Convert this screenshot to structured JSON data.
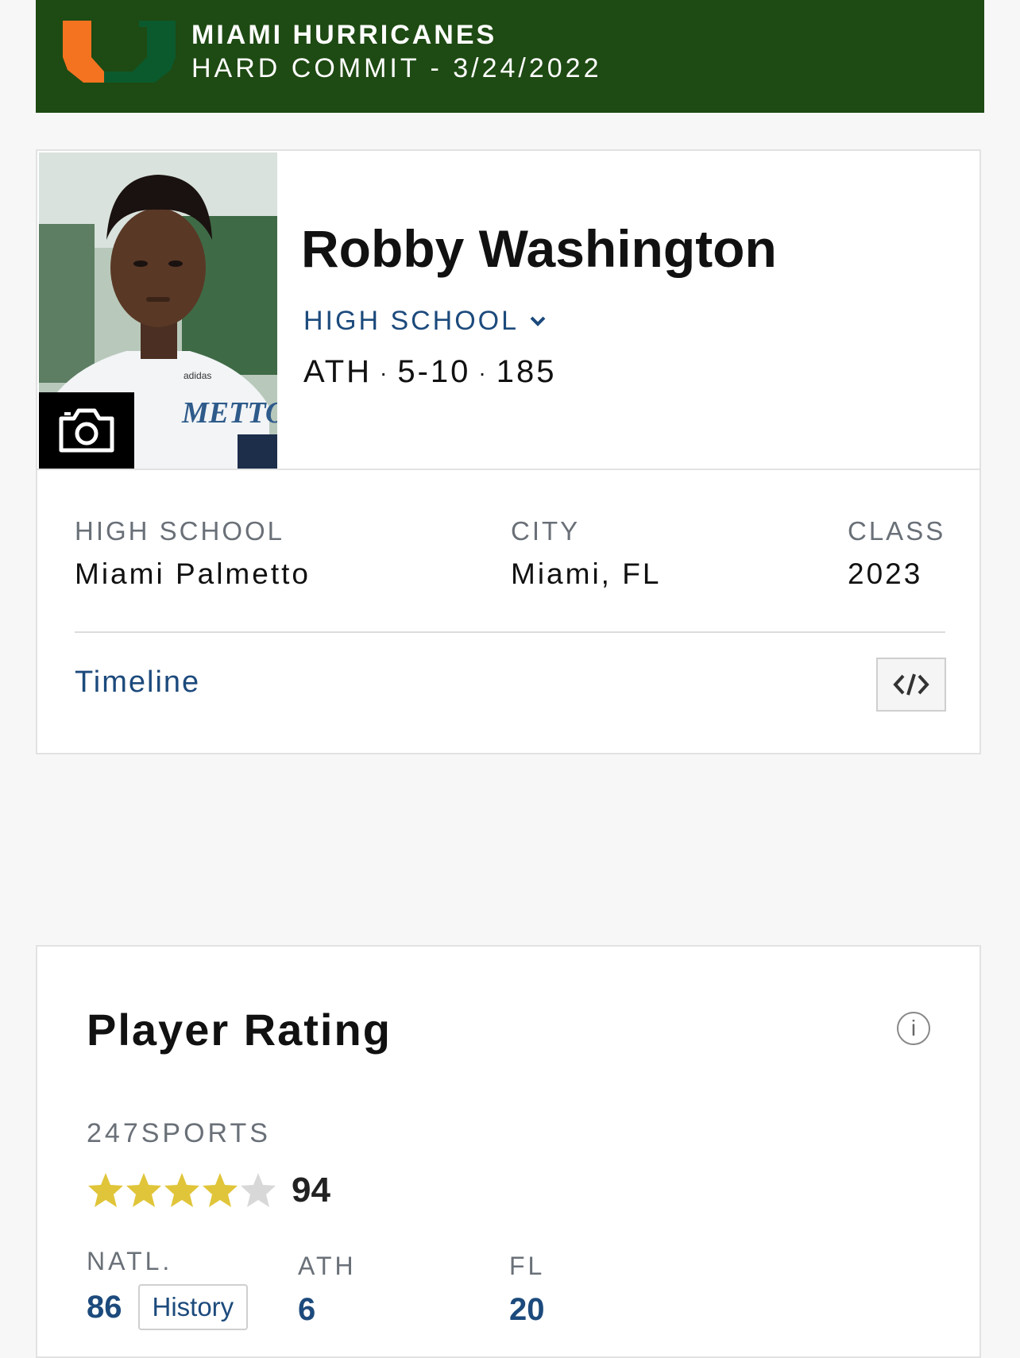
{
  "banner": {
    "team": "MIAMI HURRICANES",
    "commit_status": "HARD COMMIT - 3/24/2022",
    "logo_colors": {
      "orange": "#f47321",
      "green": "#005030"
    },
    "background": "#1e4a13"
  },
  "profile": {
    "name": "Robby Washington",
    "level_selector": "HIGH SCHOOL",
    "position": "ATH",
    "height": "5-10",
    "weight": "185",
    "photo_jersey_text": "METTO",
    "photo_brand_text": "adidas",
    "camera_icon": "camera-icon"
  },
  "info": {
    "high_school_label": "HIGH SCHOOL",
    "high_school_value": "Miami Palmetto",
    "city_label": "CITY",
    "city_value": "Miami, FL",
    "class_label": "CLASS",
    "class_value": "2023",
    "timeline_link": "Timeline",
    "embed_icon": "code-embed-icon"
  },
  "rating": {
    "title": "Player Rating",
    "source": "247SPORTS",
    "stars_filled": 4,
    "stars_total": 5,
    "score": "94",
    "natl_label": "NATL.",
    "natl_value": "86",
    "history_button": "History",
    "position_label": "ATH",
    "position_value": "6",
    "state_label": "FL",
    "state_value": "20"
  },
  "colors": {
    "link_blue": "#1c4a7c",
    "star_gold": "#e0c53a",
    "star_empty": "#d8d8d8"
  }
}
